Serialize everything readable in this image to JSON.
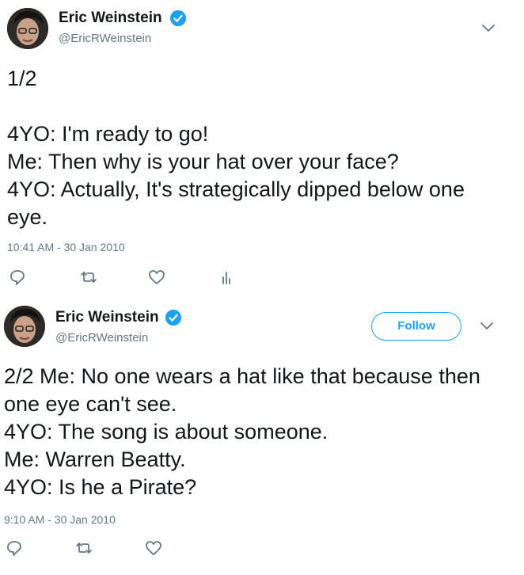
{
  "colors": {
    "accent": "#1da1f2",
    "text": "#14171a",
    "muted": "#657786"
  },
  "tweets": [
    {
      "author": {
        "name": "Eric Weinstein",
        "handle": "@EricRWeinstein",
        "verified_icon": "verified-badge-icon"
      },
      "text": "1/2\n\n4YO: I'm ready to go!\nMe: Then why is your hat over your face?\n4YO: Actually, It's strategically dipped below one eye.",
      "timestamp": "10:41 AM - 30 Jan 2010",
      "actions": [
        "reply-icon",
        "retweet-icon",
        "like-icon",
        "analytics-icon"
      ]
    },
    {
      "author": {
        "name": "Eric Weinstein",
        "handle": "@EricRWeinstein",
        "verified_icon": "verified-badge-icon"
      },
      "follow_label": "Follow",
      "text": "2/2 Me: No one wears a hat like that because then one eye can't see.\n4YO: The song is about someone.\nMe: Warren Beatty.\n4YO: Is he a Pirate?",
      "timestamp": "9:10 AM - 30 Jan 2010",
      "actions": [
        "reply-icon",
        "retweet-icon",
        "like-icon"
      ]
    }
  ]
}
